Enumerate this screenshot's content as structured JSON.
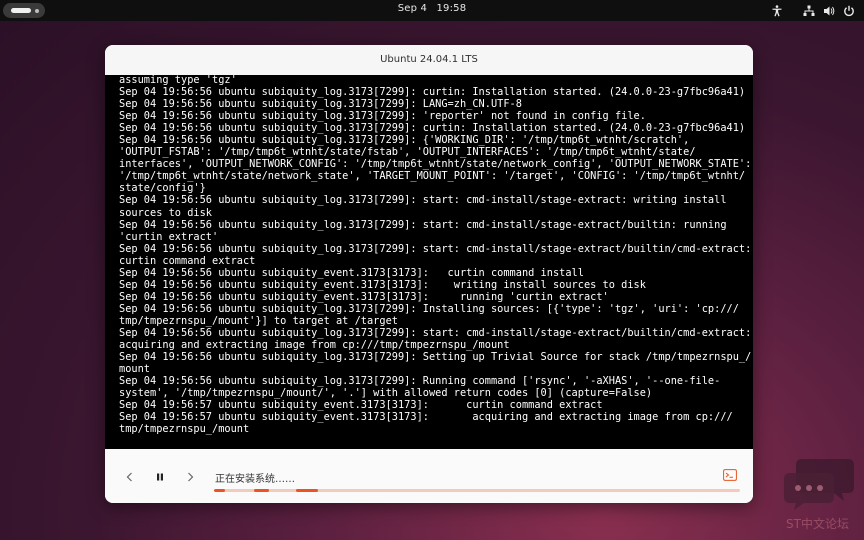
{
  "topbar": {
    "date": "Sep 4",
    "time": "19:58",
    "icons": [
      "accessibility-icon",
      "network-icon",
      "volume-icon",
      "power-icon"
    ]
  },
  "window": {
    "title": "Ubuntu 24.04.1 LTS"
  },
  "terminal": {
    "lines": [
      "assuming type 'tgz'",
      "Sep 04 19:56:56 ubuntu subiquity_log.3173[7299]: curtin: Installation started. (24.0.0-23-g7fbc96a41)",
      "Sep 04 19:56:56 ubuntu subiquity_log.3173[7299]: LANG=zh_CN.UTF-8",
      "Sep 04 19:56:56 ubuntu subiquity_log.3173[7299]: 'reporter' not found in config file.",
      "Sep 04 19:56:56 ubuntu subiquity_log.3173[7299]: curtin: Installation started. (24.0.0-23-g7fbc96a41)",
      "Sep 04 19:56:56 ubuntu subiquity_log.3173[7299]: {'WORKING_DIR': '/tmp/tmp6t_wtnht/scratch',",
      "'OUTPUT_FSTAB': '/tmp/tmp6t_wtnht/state/fstab', 'OUTPUT_INTERFACES': '/tmp/tmp6t_wtnht/state/",
      "interfaces', 'OUTPUT_NETWORK_CONFIG': '/tmp/tmp6t_wtnht/state/network_config', 'OUTPUT_NETWORK_STATE':",
      "'/tmp/tmp6t_wtnht/state/network_state', 'TARGET_MOUNT_POINT': '/target', 'CONFIG': '/tmp/tmp6t_wtnht/",
      "state/config'}",
      "Sep 04 19:56:56 ubuntu subiquity_log.3173[7299]: start: cmd-install/stage-extract: writing install",
      "sources to disk",
      "Sep 04 19:56:56 ubuntu subiquity_log.3173[7299]: start: cmd-install/stage-extract/builtin: running",
      "'curtin extract'",
      "Sep 04 19:56:56 ubuntu subiquity_log.3173[7299]: start: cmd-install/stage-extract/builtin/cmd-extract:",
      "curtin command extract",
      "Sep 04 19:56:56 ubuntu subiquity_event.3173[3173]:   curtin command install",
      "Sep 04 19:56:56 ubuntu subiquity_event.3173[3173]:    writing install sources to disk",
      "Sep 04 19:56:56 ubuntu subiquity_event.3173[3173]:     running 'curtin extract'",
      "Sep 04 19:56:56 ubuntu subiquity_log.3173[7299]: Installing sources: [{'type': 'tgz', 'uri': 'cp:///",
      "tmp/tmpezrnspu_/mount'}] to target at /target",
      "Sep 04 19:56:56 ubuntu subiquity_log.3173[7299]: start: cmd-install/stage-extract/builtin/cmd-extract:",
      "acquiring and extracting image from cp:///tmp/tmpezrnspu_/mount",
      "Sep 04 19:56:56 ubuntu subiquity_log.3173[7299]: Setting up Trivial Source for stack /tmp/tmpezrnspu_/",
      "mount",
      "Sep 04 19:56:56 ubuntu subiquity_log.3173[7299]: Running command ['rsync', '-aXHAS', '--one-file-",
      "system', '/tmp/tmpezrnspu_/mount/', '.'] with allowed return codes [0] (capture=False)",
      "Sep 04 19:56:57 ubuntu subiquity_event.3173[3173]:      curtin command extract",
      "Sep 04 19:56:57 ubuntu subiquity_event.3173[3173]:       acquiring and extracting image from cp:///",
      "tmp/tmpezrnspu_/mount"
    ]
  },
  "footer": {
    "status": "正在安装系统……",
    "progress_indeterminate": true,
    "colors": {
      "track": "#f3cbbd",
      "accent": "#e95420"
    }
  },
  "watermark": {
    "text": "ST中文论坛"
  }
}
